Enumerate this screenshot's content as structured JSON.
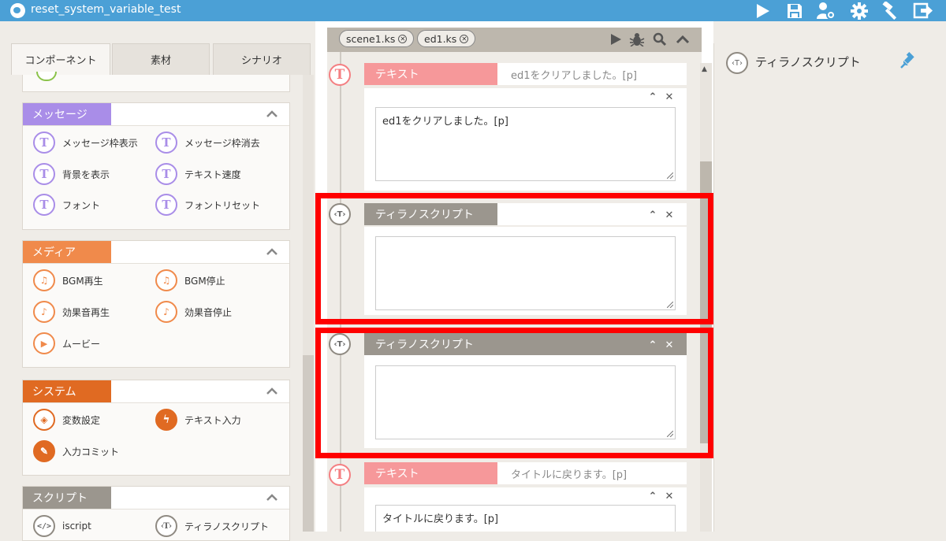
{
  "window": {
    "title": "reset_system_variable_test"
  },
  "toolbar": {
    "icons": [
      "play-icon",
      "save-icon",
      "users-settings-icon",
      "gear-icon",
      "build-hammer-icon",
      "export-icon"
    ]
  },
  "left_panel": {
    "tabs": [
      {
        "label": "コンポーネント",
        "active": true
      },
      {
        "label": "素材",
        "active": false
      },
      {
        "label": "シナリオ",
        "active": false
      }
    ],
    "sections": [
      {
        "title": "メッセージ",
        "color": "#a98de8",
        "items": [
          {
            "label": "メッセージ枠表示",
            "icon": "message-frame-show-icon"
          },
          {
            "label": "メッセージ枠消去",
            "icon": "message-frame-hide-icon"
          },
          {
            "label": "背景を表示",
            "icon": "background-show-icon"
          },
          {
            "label": "テキスト速度",
            "icon": "text-speed-icon"
          },
          {
            "label": "フォント",
            "icon": "font-icon"
          },
          {
            "label": "フォントリセット",
            "icon": "font-reset-icon"
          }
        ]
      },
      {
        "title": "メディア",
        "color": "#f08a4b",
        "items": [
          {
            "label": "BGM再生",
            "icon": "bgm-play-icon"
          },
          {
            "label": "BGM停止",
            "icon": "bgm-stop-icon"
          },
          {
            "label": "効果音再生",
            "icon": "se-play-icon"
          },
          {
            "label": "効果音停止",
            "icon": "se-stop-icon"
          },
          {
            "label": "ムービー",
            "icon": "movie-icon"
          }
        ]
      },
      {
        "title": "システム",
        "color": "#e06a22",
        "items": [
          {
            "label": "変数設定",
            "icon": "variable-set-icon"
          },
          {
            "label": "テキスト入力",
            "icon": "text-input-icon"
          },
          {
            "label": "入力コミット",
            "icon": "input-commit-icon"
          }
        ]
      },
      {
        "title": "スクリプト",
        "color": "#9b968e",
        "items": [
          {
            "label": "iscript",
            "icon": "iscript-icon"
          },
          {
            "label": "ティラノスクリプト",
            "icon": "tyrano-script-icon"
          }
        ]
      }
    ]
  },
  "center_panel": {
    "file_tabs": [
      {
        "label": "scene1.ks"
      },
      {
        "label": "ed1.ks"
      }
    ],
    "bar_icons": [
      "run-icon",
      "debug-bug-icon",
      "search-icon",
      "collapse-up-icon"
    ],
    "blocks": [
      {
        "type": "text",
        "label": "テキスト",
        "summary": "ed1をクリアしました。[p]",
        "body": "ed1をクリアしました。[p]",
        "color": "#f6989a"
      },
      {
        "type": "tyrano",
        "label": "ティラノスクリプト",
        "summary": "",
        "body": "",
        "color": "#9b968e",
        "highlighted": true
      },
      {
        "type": "tyrano",
        "label": "ティラノスクリプト",
        "summary": "",
        "body": "",
        "color": "#9b968e",
        "highlighted": true
      },
      {
        "type": "text",
        "label": "テキスト",
        "summary": "タイトルに戻ります。[p]",
        "body": "タイトルに戻ります。[p]",
        "color": "#f6989a"
      }
    ],
    "tag_glyph_text": "T",
    "tag_glyph_tyrano": "‹T›"
  },
  "right_panel": {
    "title": "ティラノスクリプト",
    "icon_glyph": "‹T›"
  }
}
